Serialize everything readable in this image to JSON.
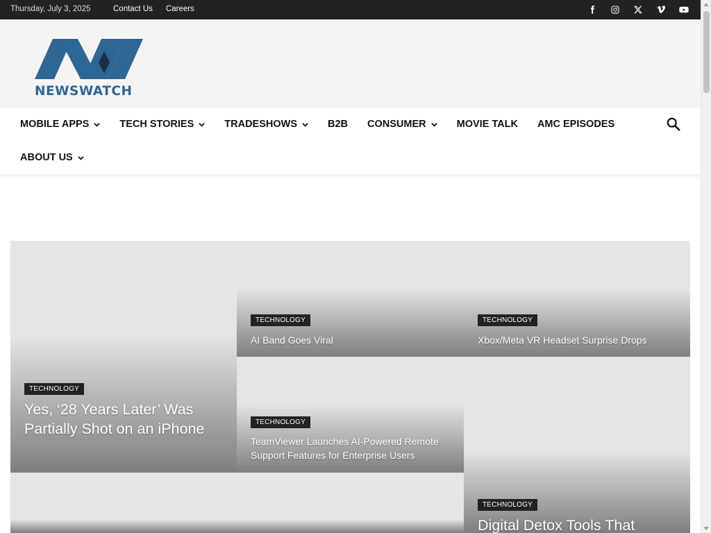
{
  "topbar": {
    "date": "Thursday, July 3, 2025",
    "links": [
      "Contact Us",
      "Careers"
    ],
    "social_icons": [
      "facebook-icon",
      "instagram-icon",
      "x-icon",
      "vimeo-icon",
      "youtube-icon"
    ]
  },
  "header": {
    "logo_text": "NEWSWATCH",
    "brand_color": "#2e6694"
  },
  "nav": {
    "items": [
      {
        "label": "MOBILE APPS",
        "dropdown": true
      },
      {
        "label": "TECH STORIES",
        "dropdown": true
      },
      {
        "label": "TRADESHOWS",
        "dropdown": true
      },
      {
        "label": "B2B",
        "dropdown": false
      },
      {
        "label": "CONSUMER",
        "dropdown": true
      },
      {
        "label": "MOVIE TALK",
        "dropdown": false
      },
      {
        "label": "AMC EPISODES",
        "dropdown": false
      },
      {
        "label": "ABOUT US",
        "dropdown": true
      }
    ]
  },
  "articles": [
    {
      "category": "TECHNOLOGY",
      "title": "Yes, ‘28 Years Later’ Was Partially Shot on an iPhone"
    },
    {
      "category": "TECHNOLOGY",
      "title": "AI Band Goes Viral"
    },
    {
      "category": "TECHNOLOGY",
      "title": "Xbox/Meta VR Headset Surprise Drops"
    },
    {
      "category": "TECHNOLOGY",
      "title": "TeamViewer Launches AI-Powered Remote Support Features for Enterprise Users"
    },
    {
      "category": "TECHNOLOGY",
      "title": "Digital Detox Tools That"
    }
  ]
}
